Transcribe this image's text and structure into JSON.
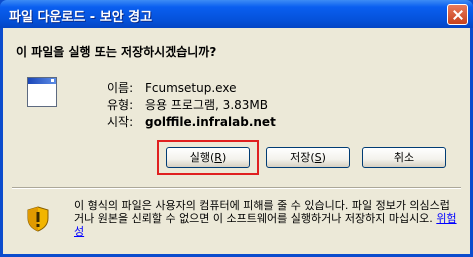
{
  "window": {
    "title": "파일 다운로드 - 보안 경고"
  },
  "dialog": {
    "question": "이 파일을 실행 또는 저장하시겠습니까?",
    "file": {
      "name_label": "이름:",
      "name_value": "Fcumsetup.exe",
      "type_label": "유형:",
      "type_value": "응용 프로그램, 3.83MB",
      "from_label": "시작:",
      "from_value": "golffile.infralab.net",
      "icon": "application-window-icon"
    },
    "buttons": {
      "run_prefix": "실행(",
      "run_key": "R",
      "run_suffix": ")",
      "save_prefix": "저장(",
      "save_key": "S",
      "save_suffix": ")",
      "cancel": "취소"
    },
    "warning": {
      "text": "이 형식의 파일은 사용자의 컴퓨터에 피해를 줄 수 있습니다. 파일 정보가 의심스럽거나 원본을 신뢰할 수 없으면 이 소프트웨어를 실행하거나 저장하지 마십시오.",
      "link": "위험성",
      "icon": "security-shield-icon"
    }
  },
  "colors": {
    "titlebar": "#0552db",
    "client_background": "#ece9d8",
    "highlight": "#e02020",
    "link": "#0000ff"
  }
}
